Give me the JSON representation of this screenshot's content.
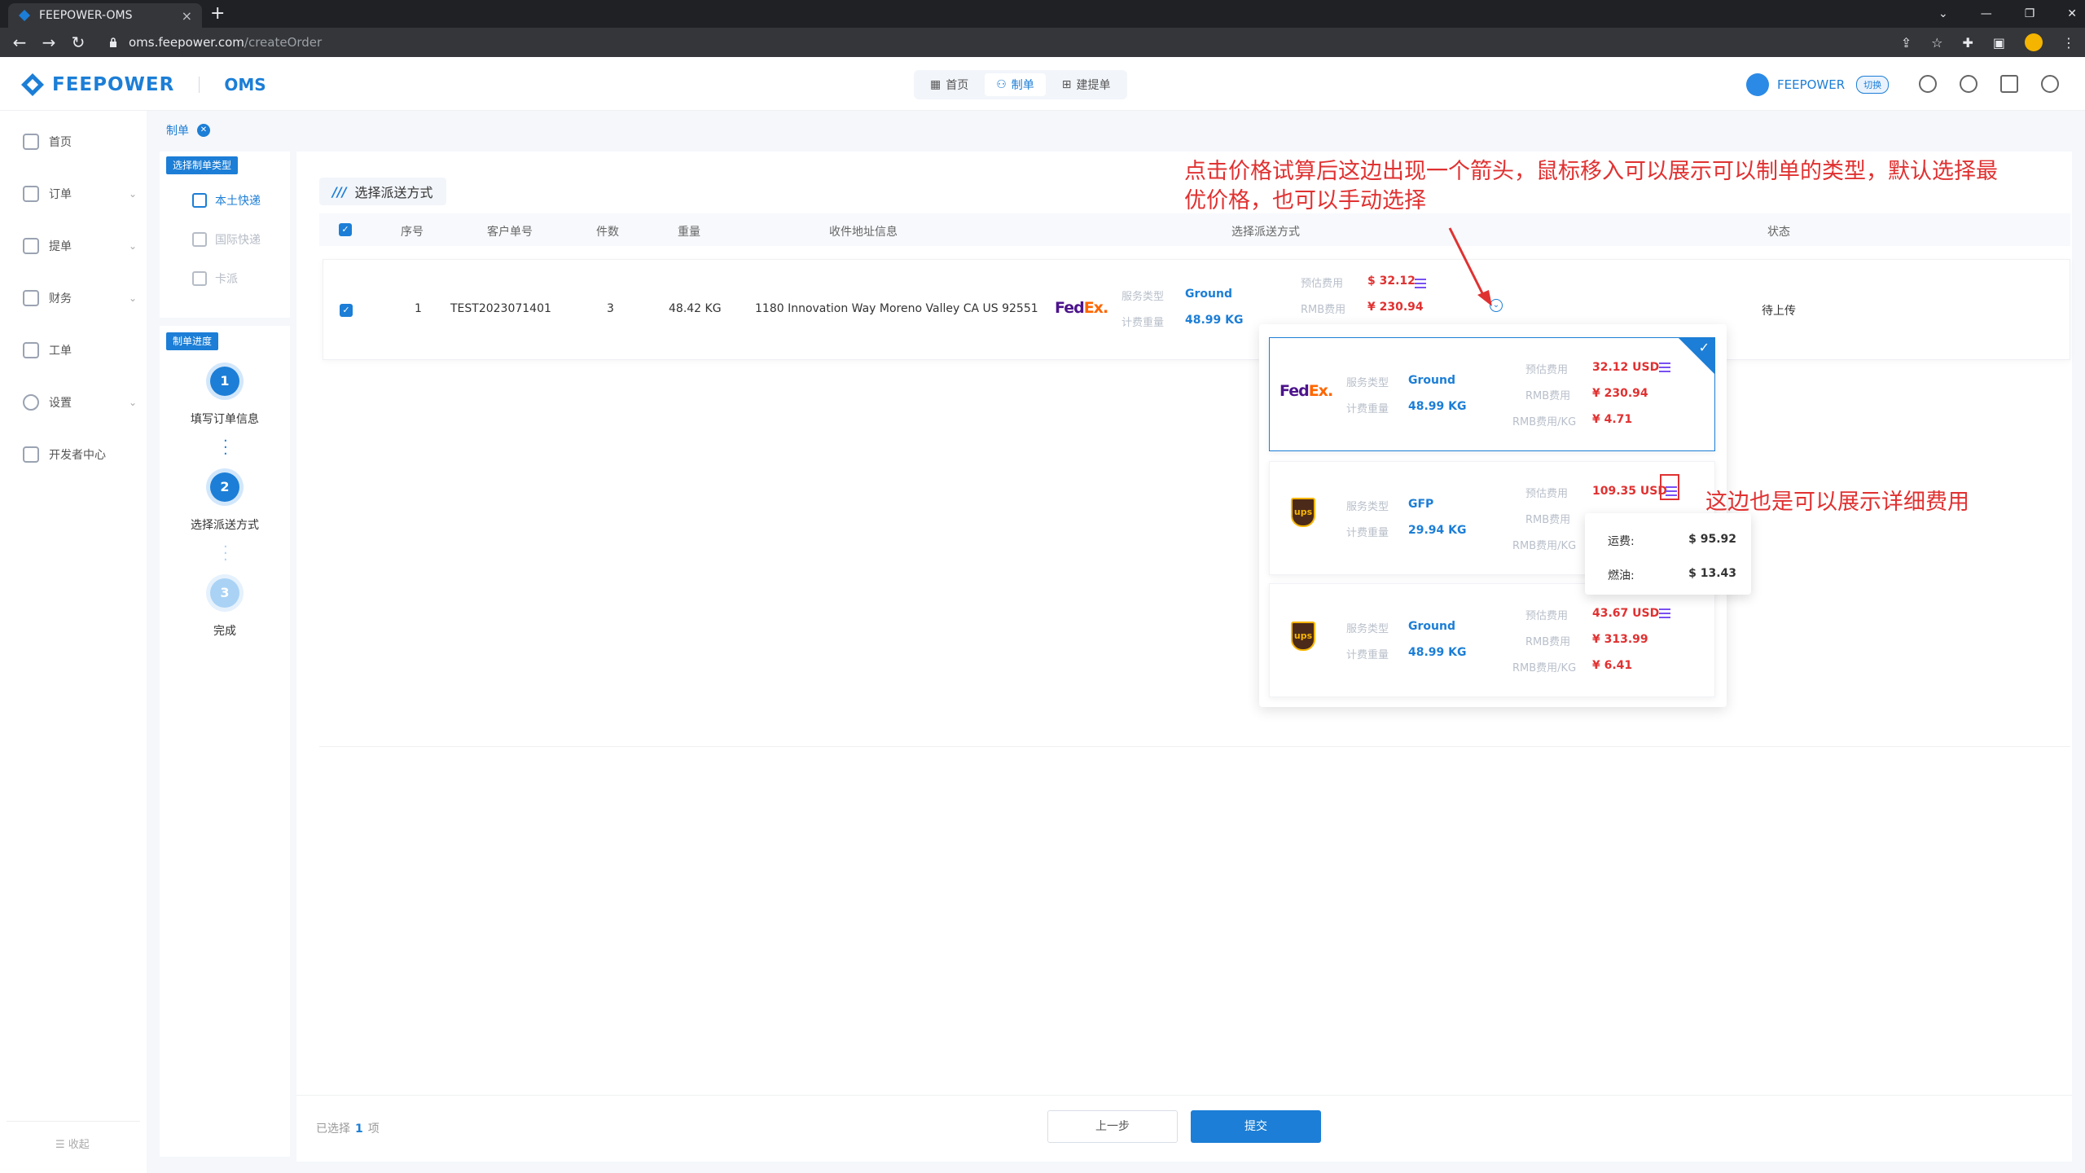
{
  "browser": {
    "tab_title": "FEEPOWER-OMS",
    "url_host": "oms.feepower.com",
    "url_path": "/createOrder"
  },
  "header": {
    "brand": "FEEPOWER",
    "product": "OMS",
    "nav": [
      {
        "label": "首页"
      },
      {
        "label": "制单"
      },
      {
        "label": "建提单"
      }
    ],
    "user": "FEEPOWER",
    "switch_label": "切换"
  },
  "sidebar": {
    "items": [
      {
        "label": "首页",
        "expandable": false
      },
      {
        "label": "订单",
        "expandable": true
      },
      {
        "label": "提单",
        "expandable": true
      },
      {
        "label": "财务",
        "expandable": true
      },
      {
        "label": "工单",
        "expandable": false
      },
      {
        "label": "设置",
        "expandable": true
      },
      {
        "label": "开发者中心",
        "expandable": false
      }
    ],
    "collapse_label": "收起"
  },
  "breadcrumb": {
    "label": "制单"
  },
  "order_type_panel": {
    "badge": "选择制单类型",
    "types": [
      "本土快递",
      "国际快递",
      "卡派"
    ]
  },
  "progress_panel": {
    "badge": "制单进度",
    "steps": [
      {
        "num": "1",
        "label": "填写订单信息"
      },
      {
        "num": "2",
        "label": "选择派送方式"
      },
      {
        "num": "3",
        "label": "完成"
      }
    ]
  },
  "section": {
    "title": "选择派送方式"
  },
  "table": {
    "headers": [
      "序号",
      "客户单号",
      "件数",
      "重量",
      "收件地址信息",
      "选择派送方式",
      "状态"
    ],
    "row": {
      "index": "1",
      "customer_no": "TEST2023071401",
      "pieces": "3",
      "weight": "48.42 KG",
      "address": "1180 Innovation Way Moreno Valley CA US 92551",
      "carrier": "FedEx",
      "service_label": "服务类型",
      "service": "Ground",
      "billing_weight_label": "计费重量",
      "billing_weight": "48.99 KG",
      "est_fee_label": "预估费用",
      "est_fee": "$ 32.12",
      "rmb_label": "RMB费用",
      "rmb_fee": "¥ 230.94",
      "status": "待上传"
    }
  },
  "options": {
    "labels": {
      "service": "服务类型",
      "weight": "计费重量",
      "est": "预估费用",
      "rmb": "RMB费用",
      "rmb_kg": "RMB费用/KG"
    },
    "cards": [
      {
        "carrier": "FedEx",
        "service": "Ground",
        "weight": "48.99 KG",
        "est": "32.12 USD",
        "rmb": "¥ 230.94",
        "rmb_kg": "¥ 4.71",
        "selected": true
      },
      {
        "carrier": "UPS",
        "service": "GFP",
        "weight": "29.94 KG",
        "est": "109.35 USD",
        "rmb": "",
        "rmb_kg": "",
        "selected": false
      },
      {
        "carrier": "UPS",
        "service": "Ground",
        "weight": "48.99 KG",
        "est": "43.67 USD",
        "rmb": "¥ 313.99",
        "rmb_kg": "¥ 6.41",
        "selected": false
      }
    ]
  },
  "fee_tooltip": {
    "rows": [
      {
        "label": "运费:",
        "value": "$ 95.92"
      },
      {
        "label": "燃油:",
        "value": "$ 13.43"
      }
    ]
  },
  "annotations": {
    "top_line1": "点击价格试算后这边出现一个箭头，鼠标移入可以展示可以制单的类型，默认选择最",
    "top_line2": "优价格，也可以手动选择",
    "right": "这边也是可以展示详细费用",
    "color": "#e03131"
  },
  "footer": {
    "selected_prefix": "已选择",
    "selected_count": "1",
    "selected_suffix": "项",
    "prev_label": "上一步",
    "submit_label": "提交"
  },
  "colors": {
    "accent": "#1c7ed6",
    "price": "#e03131"
  }
}
